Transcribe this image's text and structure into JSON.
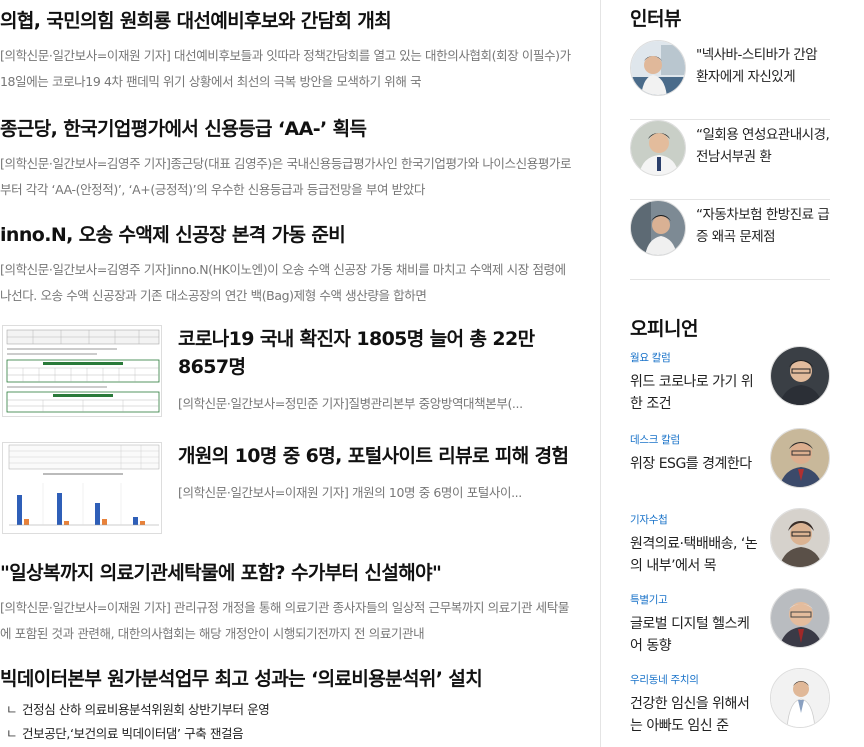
{
  "articles": [
    {
      "title": "의협, 국민의힘 원희룡 대선예비후보와 간담회 개최",
      "excerpt": "[의학신문·일간보사=이재원 기자] 대선예비후보들과 잇따라 정책간담회를 열고 있는 대한의사협회(회장 이필수)가 18일에는 코로나19 4차 팬데믹 위기 상황에서 최선의 극복 방안을 모색하기 위해 국"
    },
    {
      "title": "종근당, 한국기업평가에서 신용등급 ‘AA-’ 획득",
      "excerpt": "[의학신문·일간보사=김영주 기자]종근당(대표 김영주)은 국내신용등급평가사인 한국기업평가와 나이스신용평가로부터 각각 ‘AA-(안정적)’, ‘A+(긍정적)’의 우수한 신용등급과 등급전망을 부여 받았다"
    },
    {
      "title": "inno.N, 오송 수액제 신공장 본격 가동 준비",
      "excerpt": "[의학신문·일간보사=김영주 기자]inno.N(HK이노엔)이 오송 수액 신공장 가동 채비를 마치고 수액제 시장 점령에 나선다. 오송 수액 신공장과 기존 대소공장의 연간 백(Bag)제형 수액 생산량을 합하면"
    }
  ],
  "thumb_articles": [
    {
      "title": "코로나19 국내 확진자 1805명 늘어 총 22만 8657명",
      "excerpt": "[의학신문·일간보사=정민준 기자]질병관리본부 중앙방역대책본부(..."
    },
    {
      "title": "개원의 10명 중 6명, 포털사이트 리뷰로 피해 경험",
      "excerpt": "[의학신문·일간보사=이재원 기자] 개원의 10명 중 6명이 포털사이..."
    }
  ],
  "lower_articles": [
    {
      "title": "\"일상복까지 의료기관세탁물에 포함? 수가부터 신설해야\"",
      "excerpt": "[의학신문·일간보사=이재원 기자] 관리규정 개정을 통해 의료기관 종사자들의 일상적 근무복까지 의료기관 세탁물에 포함된 것과 관련해, 대한의사협회는 해당 개정안이 시행되기전까지 전 의료기관내"
    },
    {
      "title": "빅데이터본부 원가분석업무 최고 성과는 ‘의료비용분석위’ 설치",
      "excerpt": ""
    }
  ],
  "sub_list": {
    "marker": "ㄴ",
    "items": [
      "건정심 산하 의료비용분석위원회 상반기부터 운영",
      "건보공단,‘보건의료 빅데이터댐’ 구축 잰걸음"
    ]
  },
  "interview": {
    "title": "인터뷰",
    "items": [
      "\"넥사바-스티바가 간암 환자에게 자신있게",
      "“일회용 연성요관내시경, 전남서부권 환",
      "“자동차보험 한방진료 급증 왜곡 문제점"
    ]
  },
  "opinion": {
    "title": "오피니언",
    "items": [
      {
        "category": "월요 칼럼",
        "text": "위드 코로나로 가기 위한 조건"
      },
      {
        "category": "데스크 칼럼",
        "text": "위장 ESG를 경계한다"
      },
      {
        "category": "기자수첩",
        "text": "원격의료·택배배송, ‘논의 내부’에서 목"
      },
      {
        "category": "특별기고",
        "text": "글로벌 디지털 헬스케어 동향"
      },
      {
        "category": "우리동네 주치의",
        "text": "건강한 임신을 위해서는 아빠도 임신 준"
      }
    ]
  },
  "colors": {
    "accent_blue": "#1a73c9",
    "excerpt_gray": "#777777",
    "divider": "#e4e4e4",
    "chart_blue": "#2f5fb8",
    "chart_orange": "#e8823a"
  }
}
